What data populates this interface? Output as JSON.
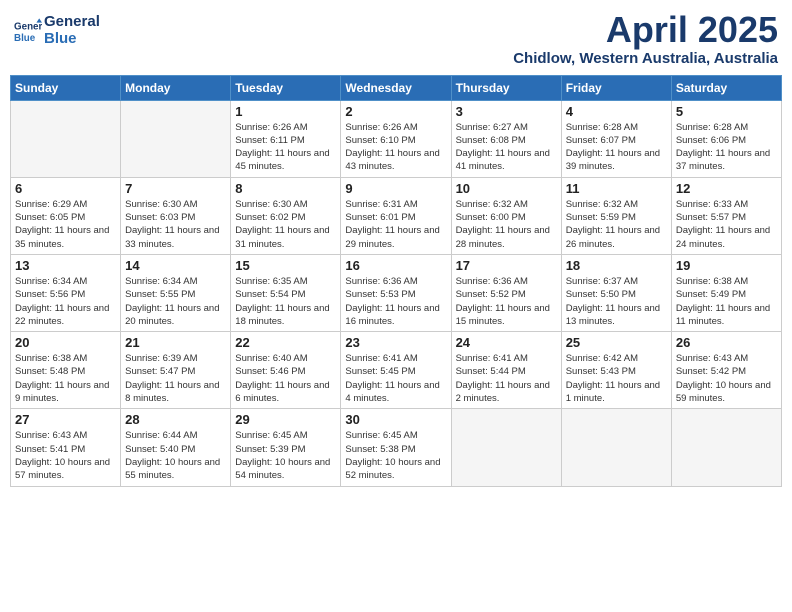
{
  "header": {
    "logo_line1": "General",
    "logo_line2": "Blue",
    "month": "April 2025",
    "location": "Chidlow, Western Australia, Australia"
  },
  "weekdays": [
    "Sunday",
    "Monday",
    "Tuesday",
    "Wednesday",
    "Thursday",
    "Friday",
    "Saturday"
  ],
  "weeks": [
    [
      {
        "day": "",
        "info": ""
      },
      {
        "day": "",
        "info": ""
      },
      {
        "day": "1",
        "info": "Sunrise: 6:26 AM\nSunset: 6:11 PM\nDaylight: 11 hours and 45 minutes."
      },
      {
        "day": "2",
        "info": "Sunrise: 6:26 AM\nSunset: 6:10 PM\nDaylight: 11 hours and 43 minutes."
      },
      {
        "day": "3",
        "info": "Sunrise: 6:27 AM\nSunset: 6:08 PM\nDaylight: 11 hours and 41 minutes."
      },
      {
        "day": "4",
        "info": "Sunrise: 6:28 AM\nSunset: 6:07 PM\nDaylight: 11 hours and 39 minutes."
      },
      {
        "day": "5",
        "info": "Sunrise: 6:28 AM\nSunset: 6:06 PM\nDaylight: 11 hours and 37 minutes."
      }
    ],
    [
      {
        "day": "6",
        "info": "Sunrise: 6:29 AM\nSunset: 6:05 PM\nDaylight: 11 hours and 35 minutes."
      },
      {
        "day": "7",
        "info": "Sunrise: 6:30 AM\nSunset: 6:03 PM\nDaylight: 11 hours and 33 minutes."
      },
      {
        "day": "8",
        "info": "Sunrise: 6:30 AM\nSunset: 6:02 PM\nDaylight: 11 hours and 31 minutes."
      },
      {
        "day": "9",
        "info": "Sunrise: 6:31 AM\nSunset: 6:01 PM\nDaylight: 11 hours and 29 minutes."
      },
      {
        "day": "10",
        "info": "Sunrise: 6:32 AM\nSunset: 6:00 PM\nDaylight: 11 hours and 28 minutes."
      },
      {
        "day": "11",
        "info": "Sunrise: 6:32 AM\nSunset: 5:59 PM\nDaylight: 11 hours and 26 minutes."
      },
      {
        "day": "12",
        "info": "Sunrise: 6:33 AM\nSunset: 5:57 PM\nDaylight: 11 hours and 24 minutes."
      }
    ],
    [
      {
        "day": "13",
        "info": "Sunrise: 6:34 AM\nSunset: 5:56 PM\nDaylight: 11 hours and 22 minutes."
      },
      {
        "day": "14",
        "info": "Sunrise: 6:34 AM\nSunset: 5:55 PM\nDaylight: 11 hours and 20 minutes."
      },
      {
        "day": "15",
        "info": "Sunrise: 6:35 AM\nSunset: 5:54 PM\nDaylight: 11 hours and 18 minutes."
      },
      {
        "day": "16",
        "info": "Sunrise: 6:36 AM\nSunset: 5:53 PM\nDaylight: 11 hours and 16 minutes."
      },
      {
        "day": "17",
        "info": "Sunrise: 6:36 AM\nSunset: 5:52 PM\nDaylight: 11 hours and 15 minutes."
      },
      {
        "day": "18",
        "info": "Sunrise: 6:37 AM\nSunset: 5:50 PM\nDaylight: 11 hours and 13 minutes."
      },
      {
        "day": "19",
        "info": "Sunrise: 6:38 AM\nSunset: 5:49 PM\nDaylight: 11 hours and 11 minutes."
      }
    ],
    [
      {
        "day": "20",
        "info": "Sunrise: 6:38 AM\nSunset: 5:48 PM\nDaylight: 11 hours and 9 minutes."
      },
      {
        "day": "21",
        "info": "Sunrise: 6:39 AM\nSunset: 5:47 PM\nDaylight: 11 hours and 8 minutes."
      },
      {
        "day": "22",
        "info": "Sunrise: 6:40 AM\nSunset: 5:46 PM\nDaylight: 11 hours and 6 minutes."
      },
      {
        "day": "23",
        "info": "Sunrise: 6:41 AM\nSunset: 5:45 PM\nDaylight: 11 hours and 4 minutes."
      },
      {
        "day": "24",
        "info": "Sunrise: 6:41 AM\nSunset: 5:44 PM\nDaylight: 11 hours and 2 minutes."
      },
      {
        "day": "25",
        "info": "Sunrise: 6:42 AM\nSunset: 5:43 PM\nDaylight: 11 hours and 1 minute."
      },
      {
        "day": "26",
        "info": "Sunrise: 6:43 AM\nSunset: 5:42 PM\nDaylight: 10 hours and 59 minutes."
      }
    ],
    [
      {
        "day": "27",
        "info": "Sunrise: 6:43 AM\nSunset: 5:41 PM\nDaylight: 10 hours and 57 minutes."
      },
      {
        "day": "28",
        "info": "Sunrise: 6:44 AM\nSunset: 5:40 PM\nDaylight: 10 hours and 55 minutes."
      },
      {
        "day": "29",
        "info": "Sunrise: 6:45 AM\nSunset: 5:39 PM\nDaylight: 10 hours and 54 minutes."
      },
      {
        "day": "30",
        "info": "Sunrise: 6:45 AM\nSunset: 5:38 PM\nDaylight: 10 hours and 52 minutes."
      },
      {
        "day": "",
        "info": ""
      },
      {
        "day": "",
        "info": ""
      },
      {
        "day": "",
        "info": ""
      }
    ]
  ]
}
